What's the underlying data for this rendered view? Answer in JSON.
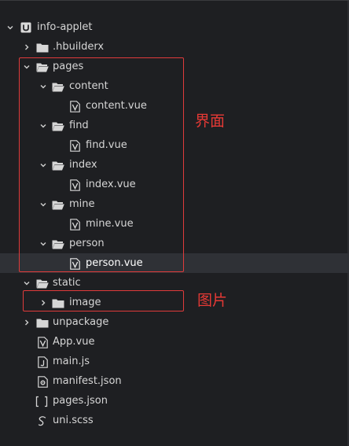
{
  "tree": {
    "root": {
      "label": "info-applet"
    },
    "hbuilderx": {
      "label": ".hbuilderx"
    },
    "pages": {
      "label": "pages",
      "content": {
        "label": "content",
        "file": "content.vue"
      },
      "find": {
        "label": "find",
        "file": "find.vue"
      },
      "index": {
        "label": "index",
        "file": "index.vue"
      },
      "mine": {
        "label": "mine",
        "file": "mine.vue"
      },
      "person": {
        "label": "person",
        "file": "person.vue"
      }
    },
    "static": {
      "label": "static",
      "image": {
        "label": "image"
      }
    },
    "unpackage": {
      "label": "unpackage"
    },
    "app_vue": {
      "label": "App.vue"
    },
    "main_js": {
      "label": "main.js"
    },
    "manifest": {
      "label": "manifest.json"
    },
    "pages_json": {
      "label": "pages.json"
    },
    "uni_scss": {
      "label": "uni.scss"
    }
  },
  "annotations": {
    "pages_box_label": "界面",
    "image_box_label": "图片",
    "color": "#e53935"
  },
  "selected_item": "person.vue"
}
